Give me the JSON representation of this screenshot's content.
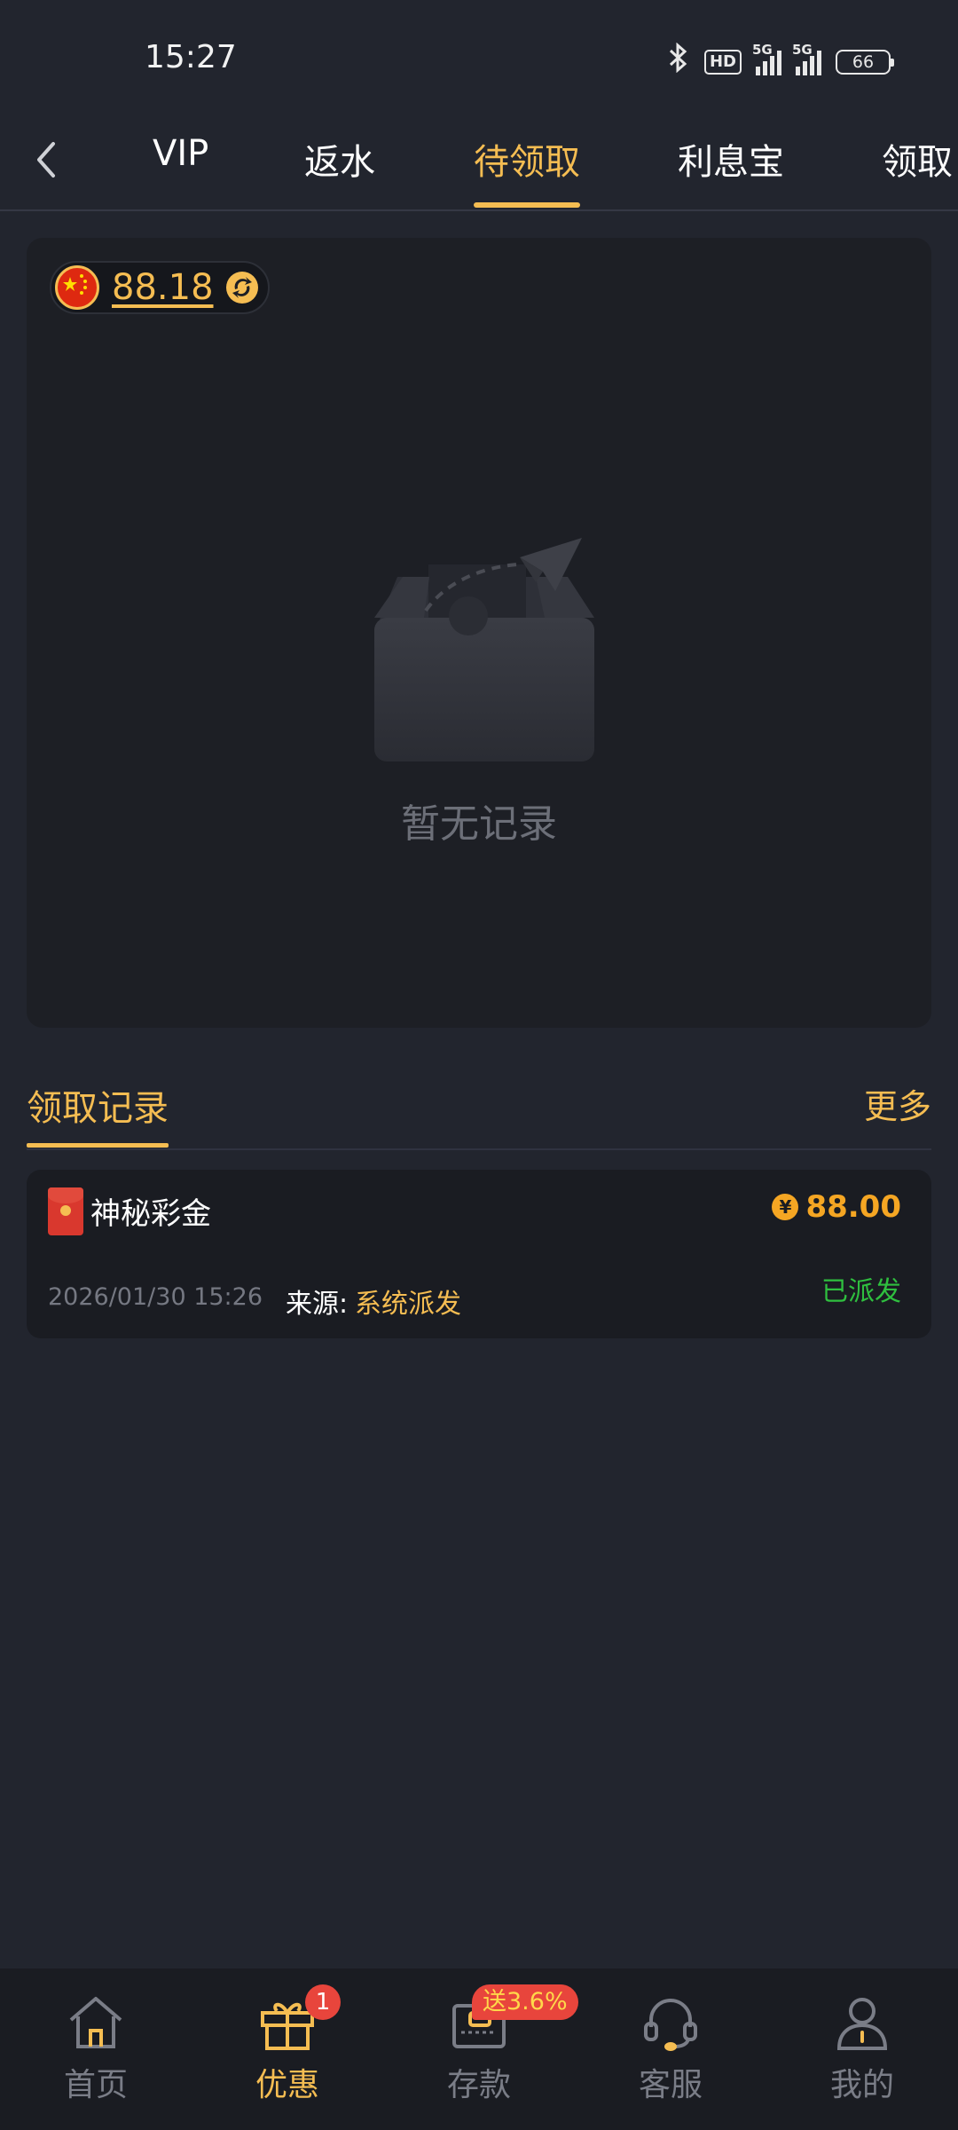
{
  "status_bar": {
    "time": "15:27",
    "hd_label": "HD",
    "signal_label": "5G",
    "battery": "66"
  },
  "tabs": [
    {
      "label": "VIP",
      "active": false
    },
    {
      "label": "返水",
      "active": false
    },
    {
      "label": "待领取",
      "active": true
    },
    {
      "label": "利息宝",
      "active": false
    },
    {
      "label": "领取",
      "active": false
    }
  ],
  "pending": {
    "currency_flag": "china-flag-icon",
    "balance": "88.18",
    "empty_text": "暂无记录"
  },
  "records": {
    "title": "领取记录",
    "more_label": "更多",
    "items": [
      {
        "name": "神秘彩金",
        "currency_symbol": "¥",
        "amount": "88.00",
        "date": "2026/01/30 15:26",
        "source_label": "来源:",
        "source_value": "系统派发",
        "status": "已派发"
      }
    ]
  },
  "bottom_nav": [
    {
      "label": "首页",
      "icon": "home-icon",
      "active": false
    },
    {
      "label": "优惠",
      "icon": "gift-icon",
      "active": true,
      "badge": "1"
    },
    {
      "label": "存款",
      "icon": "wallet-icon",
      "active": false,
      "promo": "送3.6%"
    },
    {
      "label": "客服",
      "icon": "headset-icon",
      "active": false
    },
    {
      "label": "我的",
      "icon": "user-icon",
      "active": false
    }
  ],
  "colors": {
    "accent": "#f5bd52",
    "background": "#22252e",
    "card": "#1d1f25",
    "success": "#2fbf3f",
    "badge": "#e8453c"
  }
}
